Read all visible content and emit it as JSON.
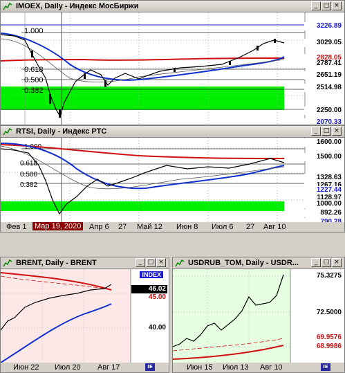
{
  "windows": {
    "imoex": {
      "title": "IMOEX, Daily - Индекс МосБиржи",
      "prices": [
        "3226.89",
        "3029.05",
        "2828.05",
        "2787.41",
        "2651.19",
        "2514.98",
        "2250.00",
        "2070.33"
      ],
      "fib": [
        "1.000",
        "0.618",
        "0.500",
        "0.382"
      ]
    },
    "rtsi": {
      "title": "RTSI, Daily - Индекс РТС",
      "prices": [
        "1600.00",
        "1500.00",
        "1328.63",
        "1267.16",
        "1227.44",
        "1128.97",
        "1000.00",
        "892.26",
        "790.28"
      ],
      "fib": [
        "1.000",
        "0.618",
        "0.500",
        "0.382"
      ],
      "dates": [
        "Фев 1",
        "Мар 19, 2020",
        "Апр 6",
        "27",
        "Май 12",
        "Июн 8",
        "Июл 6",
        "27",
        "Авг 10"
      ]
    },
    "brent": {
      "title": "BRENT, Daily - BRENT",
      "index_label": "INDEX",
      "prices": [
        "46.02",
        "45.00",
        "40.00"
      ],
      "dates": [
        "Июн 22",
        "Июл 20",
        "Авг 17"
      ]
    },
    "usdrub": {
      "title": "USDRUB_TOM, Daily - USDR...",
      "prices": [
        "75.3275",
        "72.5000",
        "69.9576",
        "68.9986"
      ],
      "dates": [
        "Июн 15",
        "Июл 13",
        "Авг 10"
      ]
    }
  },
  "window_buttons": {
    "minimize": "_",
    "maximize": "□",
    "close": "×"
  },
  "colors": {
    "green_zone": "#00ff00",
    "pink_bg": "#fde8e8",
    "lightgreen_bg": "#e6ffe0",
    "blue_ma": "#1030d0",
    "red_ma": "#d01010",
    "price_blue": "#1a1ad0",
    "price_red": "#cc1010"
  }
}
